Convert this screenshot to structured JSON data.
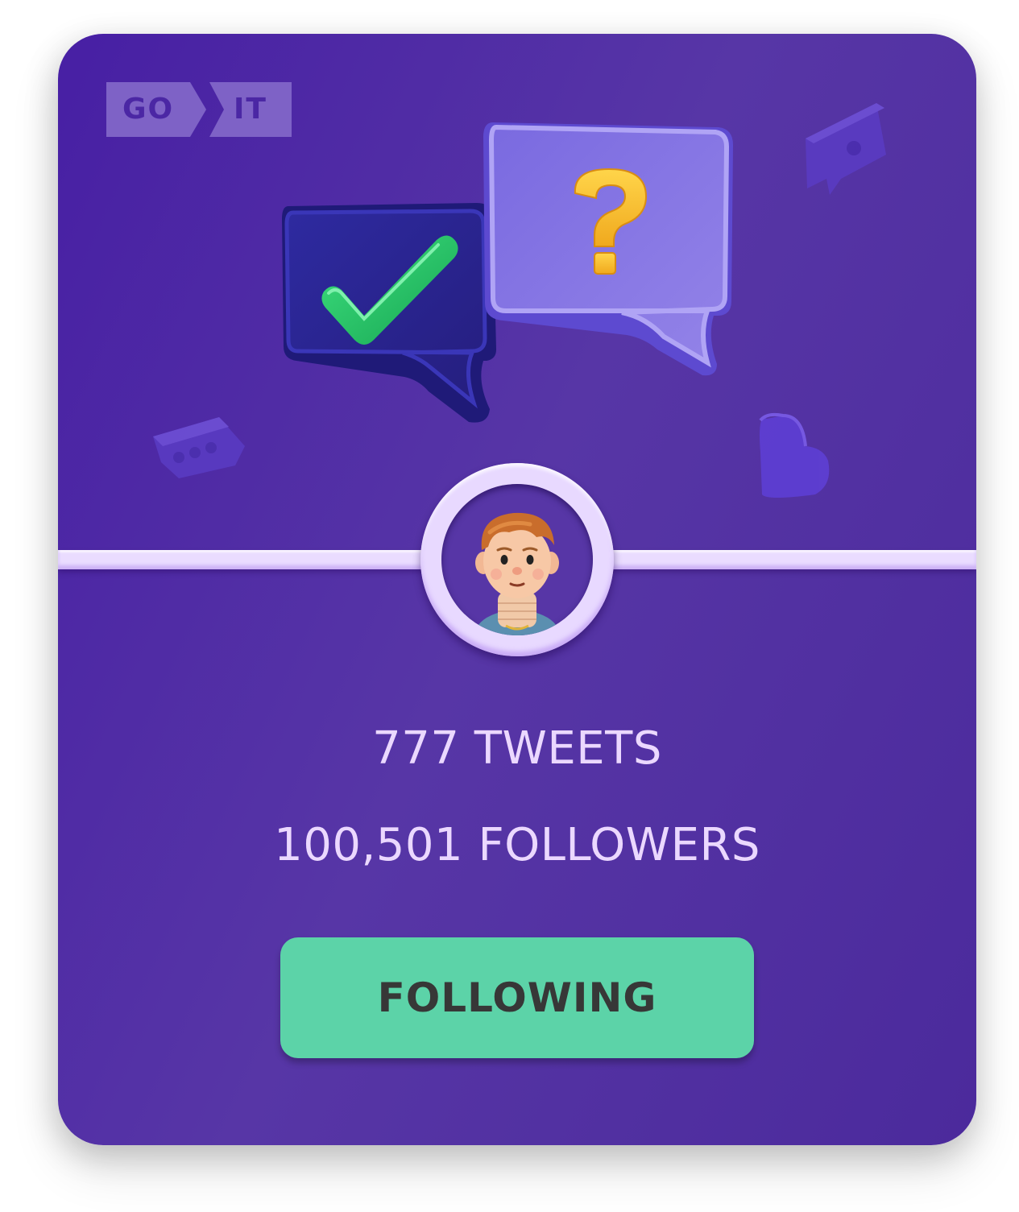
{
  "logo": {
    "left_text": "GO",
    "right_text": "IT",
    "color": "#7e62c6"
  },
  "illustration": {
    "icons": [
      "check-bubble-icon",
      "question-bubble-icon",
      "chat-bubble-icon",
      "typing-bubble-icon",
      "heart-icon"
    ],
    "check_color": "#2bc66c",
    "question_color": "#f7be2d"
  },
  "avatar": {
    "icon": "user-avatar-icon"
  },
  "stats": {
    "tweets": "777 TWEETS",
    "followers": "100,501 FOLLOWERS"
  },
  "follow_button": {
    "label": "FOLLOWING",
    "color": "#5cd3a8"
  },
  "colors": {
    "card_background": "#5736a6",
    "accent_light": "#ebd8ff",
    "text_dark": "#373737"
  }
}
